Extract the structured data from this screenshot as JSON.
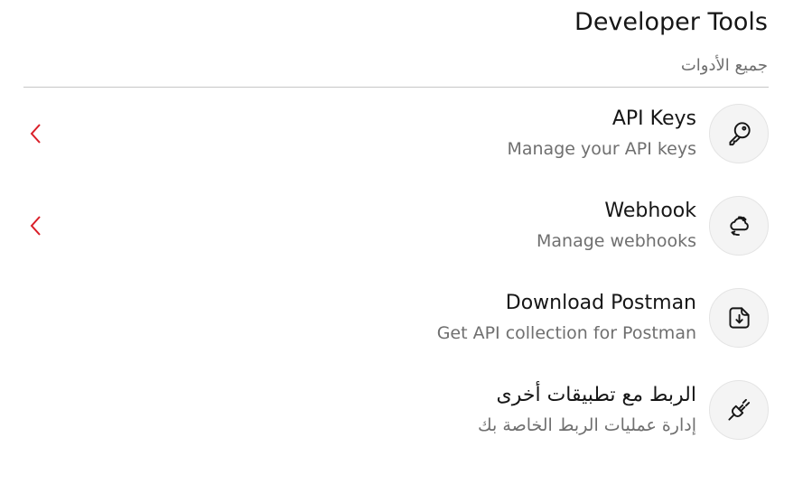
{
  "page": {
    "title": "Developer Tools",
    "subtitle": "جميع الأدوات"
  },
  "colors": {
    "accent": "#da1e28",
    "text_primary": "#161616",
    "text_secondary": "#6f6f6f",
    "icon_bg": "#f4f4f4"
  },
  "tools": [
    {
      "label": "API Keys",
      "description": "Manage your API keys",
      "icon": "key-icon",
      "has_chevron": true
    },
    {
      "label": "Webhook",
      "description": "Manage webhooks",
      "icon": "webhook-icon",
      "has_chevron": true
    },
    {
      "label": "Download Postman",
      "description": "Get API collection for Postman",
      "icon": "download-file-icon",
      "has_chevron": false
    },
    {
      "label": "الربط مع تطبيقات أخرى",
      "description": "إدارة عمليات الربط الخاصة بك",
      "icon": "plug-icon",
      "has_chevron": false
    }
  ]
}
